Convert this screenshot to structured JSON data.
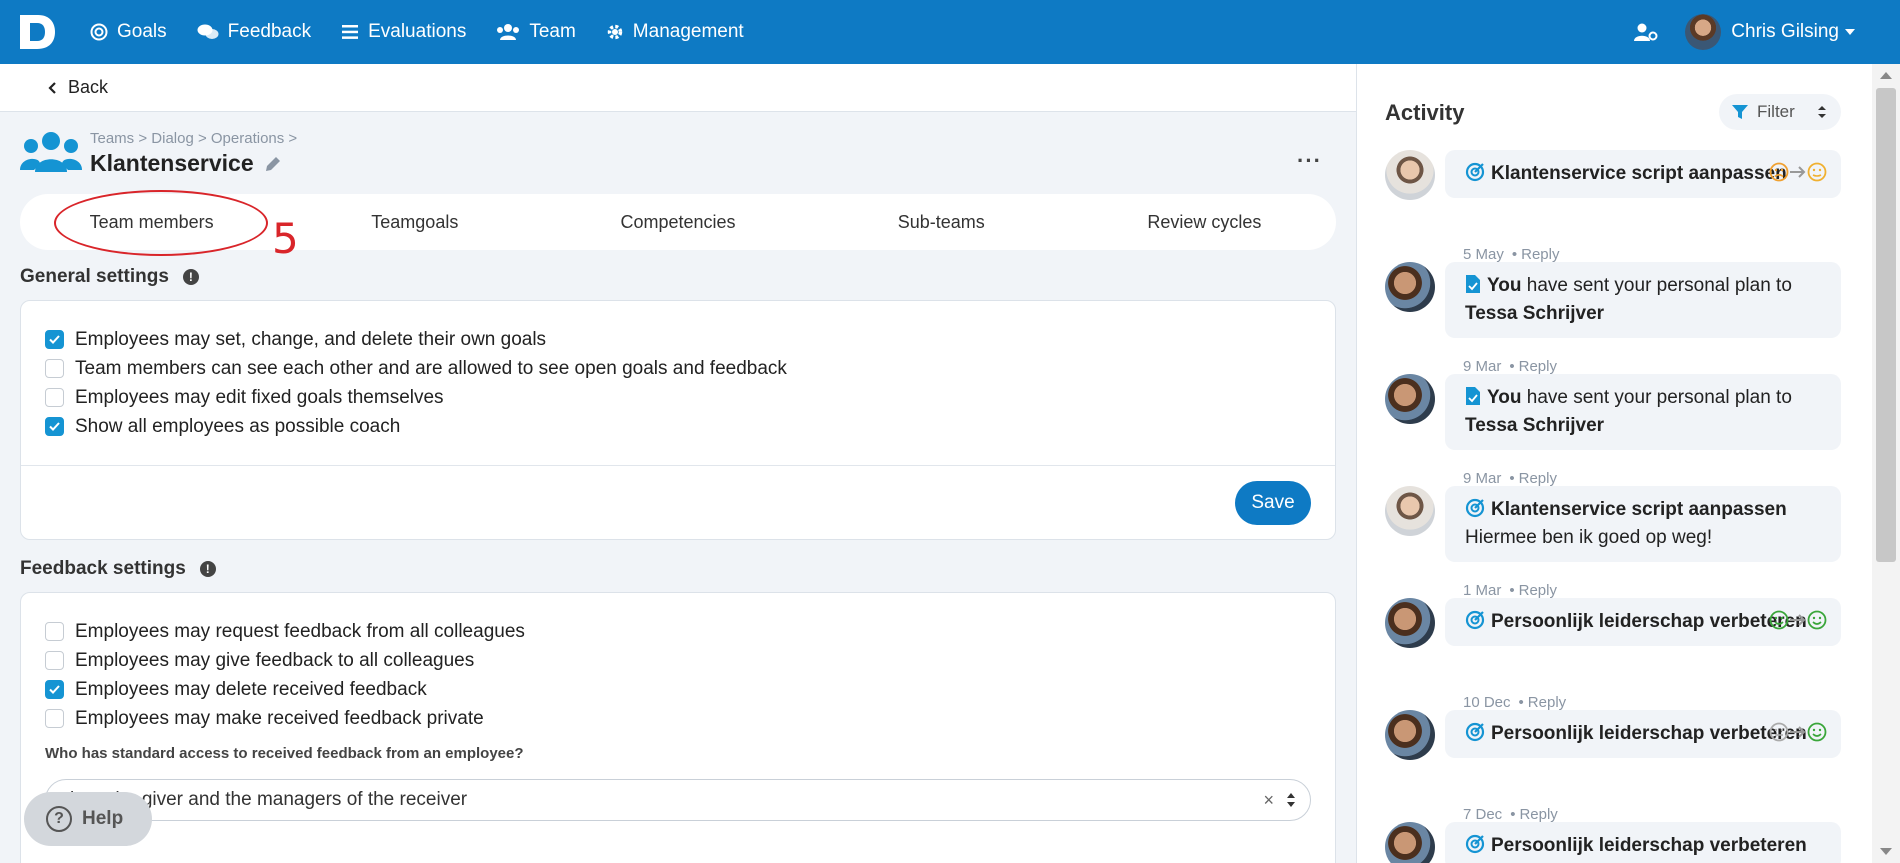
{
  "nav": {
    "items": [
      {
        "label": "Goals",
        "icon": "target-icon"
      },
      {
        "label": "Feedback",
        "icon": "chat-icon"
      },
      {
        "label": "Evaluations",
        "icon": "list-icon"
      },
      {
        "label": "Team",
        "icon": "users-icon"
      },
      {
        "label": "Management",
        "icon": "gear-icon"
      }
    ],
    "user_name": "Chris Gilsing"
  },
  "back_label": "Back",
  "team": {
    "breadcrumb": "Teams > Dialog > Operations >",
    "name": "Klantenservice",
    "more": "···"
  },
  "tabs": [
    "Team members",
    "Teamgoals",
    "Competencies",
    "Sub-teams",
    "Review cycles"
  ],
  "annotation_number": "5",
  "general_settings": {
    "title": "General settings",
    "options": [
      {
        "label": "Employees may set, change, and delete their own goals",
        "checked": true
      },
      {
        "label": "Team members can see each other and are allowed to see open goals and feedback",
        "checked": false
      },
      {
        "label": "Employees may edit fixed goals themselves",
        "checked": false
      },
      {
        "label": "Show all employees as possible coach",
        "checked": true
      }
    ],
    "save_label": "Save"
  },
  "feedback_settings": {
    "title": "Feedback settings",
    "options": [
      {
        "label": "Employees may request feedback from all colleagues",
        "checked": false
      },
      {
        "label": "Employees may give feedback to all colleagues",
        "checked": false
      },
      {
        "label": "Employees may delete received feedback",
        "checked": true
      },
      {
        "label": "Employees may make received feedback private",
        "checked": false
      }
    ],
    "question": "Who has standard access to received feedback from an employee?",
    "select_value": "iver, the giver and the managers of the receiver",
    "select_clear": "×"
  },
  "help_label": "Help",
  "activity": {
    "title": "Activity",
    "filter_label": "Filter",
    "reply_label": "Reply",
    "items": [
      {
        "type": "goal",
        "title": "Klantenservice script aanpassen",
        "date": "5 May",
        "moods": "sad-to-neutral"
      },
      {
        "type": "plan",
        "you": "You",
        "text": " have sent your personal plan to ",
        "person": "Tessa Schrijver",
        "date": "9 Mar"
      },
      {
        "type": "plan",
        "you": "You",
        "text": " have sent your personal plan to ",
        "person": "Tessa Schrijver",
        "date": "9 Mar"
      },
      {
        "type": "goal",
        "title": "Klantenservice script aanpassen",
        "body": "Hiermee ben ik goed op weg!",
        "date": "1 Mar"
      },
      {
        "type": "goal",
        "title": "Persoonlijk leiderschap verbeteren",
        "date": "10 Dec",
        "moods": "happy-to-happy"
      },
      {
        "type": "goal",
        "title": "Persoonlijk leiderschap verbeteren",
        "date": "7 Dec",
        "moods": "neutral-to-happy"
      },
      {
        "type": "goal",
        "title": "Persoonlijk leiderschap verbeteren",
        "date": ""
      }
    ]
  },
  "colors": {
    "brand": "#0e7ac4",
    "check": "#1594d3",
    "annotation": "#d9252a"
  }
}
